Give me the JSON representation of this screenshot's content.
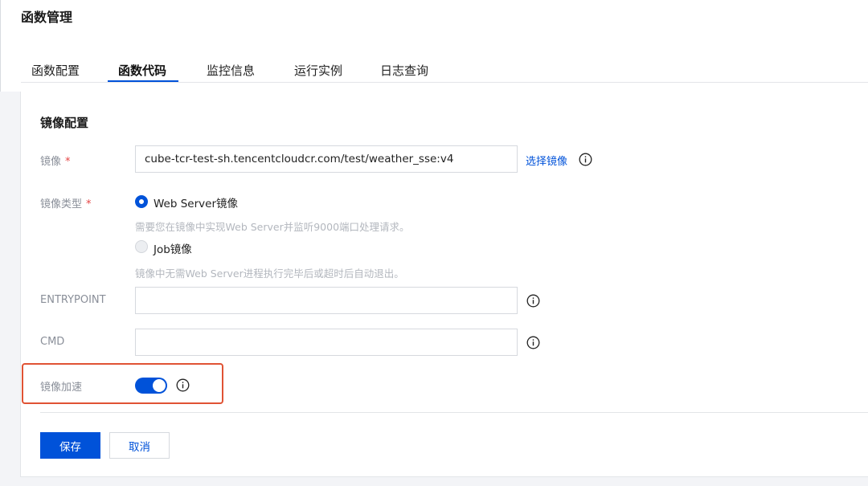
{
  "header": {
    "title": "函数管理"
  },
  "tabs": [
    {
      "label": "函数配置"
    },
    {
      "label": "函数代码"
    },
    {
      "label": "监控信息"
    },
    {
      "label": "运行实例"
    },
    {
      "label": "日志查询"
    }
  ],
  "active_tab": "函数代码",
  "form": {
    "section_title": "镜像配置",
    "required_mark": "*",
    "image": {
      "label": "镜像",
      "value": "cube-tcr-test-sh.tencentcloudcr.com/test/weather_sse:v4",
      "select_link": "选择镜像"
    },
    "image_type": {
      "label": "镜像类型",
      "options": [
        {
          "label": "Web Server镜像",
          "selected": true,
          "hint": "需要您在镜像中实现Web Server并监听9000端口处理请求。"
        },
        {
          "label": "Job镜像",
          "selected": false,
          "hint": "镜像中无需Web Server进程执行完毕后或超时后自动退出。"
        }
      ]
    },
    "entrypoint": {
      "label": "ENTRYPOINT",
      "value": ""
    },
    "cmd": {
      "label": "CMD",
      "value": ""
    },
    "image_acceleration": {
      "label": "镜像加速",
      "enabled": true
    }
  },
  "actions": {
    "save_label": "保存",
    "cancel_label": "取消"
  },
  "colors": {
    "accent": "#0052d9",
    "highlight_border": "#e05334",
    "required": "#e54545"
  }
}
